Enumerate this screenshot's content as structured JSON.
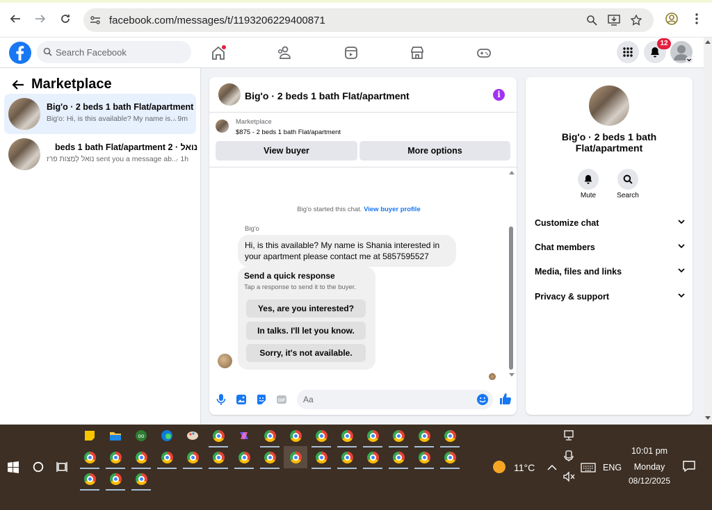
{
  "browser": {
    "url": "facebook.com/messages/t/1193206229400871"
  },
  "fb": {
    "search_placeholder": "Search Facebook",
    "notification_count": "12"
  },
  "left_panel": {
    "title": "Marketplace",
    "conversations": [
      {
        "title": "Big'o · 2 beds 1 bath Flat/apartment",
        "preview": "Big'o: Hi, is this available? My name is...",
        "time": "· 9m"
      },
      {
        "title": "נואל · 2 beds 1 bath Flat/apartment",
        "preview": "נואל לְמַצות פרז sent you a message ab...",
        "time": "· 1h"
      }
    ]
  },
  "chat": {
    "header_name": "Big'o · 2 beds 1 bath Flat/apartment",
    "marketplace_label": "Marketplace",
    "listing": "$875 - 2 beds 1 bath Flat/apartment",
    "view_buyer": "View buyer",
    "more_options": "More options",
    "system_msg": "Big'o started this chat.",
    "system_link": "View buyer profile",
    "sender": "Big'o",
    "message": "Hi, is this available? My name is Shania interested in your apartment please contact me at 5857595527",
    "quick_title": "Send a quick response",
    "quick_sub": "Tap a response to send it to the buyer.",
    "quick_responses": [
      "Yes, are you interested?",
      "In talks. I'll let you know.",
      "Sorry, it's not available."
    ],
    "composer_placeholder": "Aa"
  },
  "right_panel": {
    "title": "Big'o · 2 beds 1 bath Flat/apartment",
    "mute": "Mute",
    "search": "Search",
    "rows": [
      "Customize chat",
      "Chat members",
      "Media, files and links",
      "Privacy & support"
    ]
  },
  "taskbar": {
    "weather": "11°C",
    "lang": "ENG",
    "time": "10:01 pm",
    "day": "Monday",
    "date": "08/12/2025"
  },
  "colors": {
    "fb_blue": "#1877f2",
    "badge_red": "#e41e3f",
    "taskbar": "#3d2f24"
  }
}
